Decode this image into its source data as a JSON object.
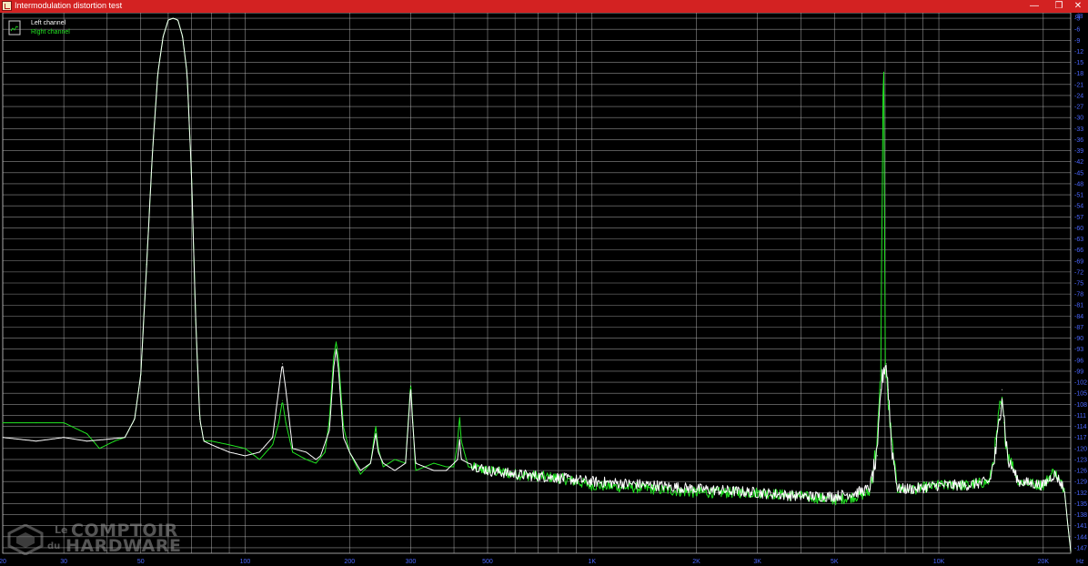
{
  "window": {
    "title": "Intermodulation distortion test",
    "minimize_glyph": "—",
    "restore_glyph": "❐",
    "close_glyph": "✕"
  },
  "watermark": {
    "line1_prefix": "Le",
    "line1": "COMPTOIR",
    "line2_prefix": "du",
    "line2": "HARDWARE"
  },
  "chart_data": {
    "type": "line",
    "title": "",
    "xlabel": "",
    "ylabel": "",
    "x_unit": "Hz",
    "y_unit": "dB",
    "x_scale": "log",
    "xlim": [
      20,
      24000
    ],
    "ylim": [
      -148.5,
      -1.5
    ],
    "grid": true,
    "legend_position": "top-left",
    "background_color": "#000000",
    "grid_color": "#bdbdbd",
    "axis_label_color": "#4a66ff",
    "x_ticks": [
      {
        "value": 20,
        "label": "20"
      },
      {
        "value": 30,
        "label": "30"
      },
      {
        "value": 50,
        "label": "50"
      },
      {
        "value": 100,
        "label": "100"
      },
      {
        "value": 200,
        "label": "200"
      },
      {
        "value": 300,
        "label": "300"
      },
      {
        "value": 500,
        "label": "500"
      },
      {
        "value": 1000,
        "label": "1K"
      },
      {
        "value": 2000,
        "label": "2K"
      },
      {
        "value": 3000,
        "label": "3K"
      },
      {
        "value": 5000,
        "label": "5K"
      },
      {
        "value": 10000,
        "label": "10K"
      },
      {
        "value": 20000,
        "label": "20K"
      }
    ],
    "y_ticks": [
      -3,
      -6,
      -9,
      -12,
      -15,
      -18,
      -21,
      -24,
      -27,
      -30,
      -33,
      -36,
      -39,
      -42,
      -45,
      -48,
      -51,
      -54,
      -57,
      -60,
      -63,
      -66,
      -69,
      -72,
      -75,
      -78,
      -81,
      -84,
      -87,
      -90,
      -93,
      -96,
      -99,
      -102,
      -105,
      -108,
      -111,
      -114,
      -117,
      -120,
      -123,
      -126,
      -129,
      -132,
      -135,
      -138,
      -141,
      -144,
      -147
    ],
    "series": [
      {
        "name": "Left channel",
        "color": "#ffffff",
        "points": [
          [
            20,
            -117
          ],
          [
            25,
            -118
          ],
          [
            30,
            -117
          ],
          [
            35,
            -118
          ],
          [
            40,
            -117.5
          ],
          [
            45,
            -117
          ],
          [
            48,
            -112
          ],
          [
            50,
            -100
          ],
          [
            52,
            -70
          ],
          [
            54,
            -40
          ],
          [
            56,
            -18
          ],
          [
            58,
            -8
          ],
          [
            60,
            -3.5
          ],
          [
            62,
            -3
          ],
          [
            64,
            -3.5
          ],
          [
            66,
            -8
          ],
          [
            68,
            -18
          ],
          [
            70,
            -45
          ],
          [
            72,
            -85
          ],
          [
            74,
            -112
          ],
          [
            76,
            -118
          ],
          [
            80,
            -119
          ],
          [
            90,
            -121
          ],
          [
            100,
            -122
          ],
          [
            110,
            -121
          ],
          [
            120,
            -117
          ],
          [
            125,
            -104
          ],
          [
            128,
            -97
          ],
          [
            131,
            -104
          ],
          [
            137,
            -120
          ],
          [
            150,
            -121
          ],
          [
            160,
            -123
          ],
          [
            165,
            -122
          ],
          [
            175,
            -115
          ],
          [
            180,
            -98
          ],
          [
            183,
            -93
          ],
          [
            186,
            -99
          ],
          [
            192,
            -117
          ],
          [
            200,
            -121
          ],
          [
            215,
            -126
          ],
          [
            230,
            -124
          ],
          [
            238,
            -116
          ],
          [
            242,
            -121
          ],
          [
            250,
            -124
          ],
          [
            270,
            -126
          ],
          [
            290,
            -124
          ],
          [
            296,
            -112
          ],
          [
            300,
            -103
          ],
          [
            304,
            -113
          ],
          [
            310,
            -124
          ],
          [
            350,
            -126
          ],
          [
            380,
            -126
          ],
          [
            400,
            -124
          ],
          [
            410,
            -123
          ],
          [
            415,
            -117
          ],
          [
            420,
            -123
          ],
          [
            440,
            -124
          ],
          [
            500,
            -126
          ],
          [
            600,
            -127
          ],
          [
            800,
            -128
          ],
          [
            1000,
            -129
          ],
          [
            1500,
            -130
          ],
          [
            2000,
            -131
          ],
          [
            3000,
            -132
          ],
          [
            4000,
            -133
          ],
          [
            5000,
            -133
          ],
          [
            5800,
            -132
          ],
          [
            6300,
            -131
          ],
          [
            6650,
            -122
          ],
          [
            6800,
            -104
          ],
          [
            6950,
            -98
          ],
          [
            7050,
            -97
          ],
          [
            7150,
            -104
          ],
          [
            7300,
            -119
          ],
          [
            7600,
            -131
          ],
          [
            8500,
            -131
          ],
          [
            10000,
            -130
          ],
          [
            12000,
            -130
          ],
          [
            14000,
            -129
          ],
          [
            14600,
            -121
          ],
          [
            15000,
            -111
          ],
          [
            15200,
            -104
          ],
          [
            15400,
            -111
          ],
          [
            15800,
            -123
          ],
          [
            17000,
            -129
          ],
          [
            20000,
            -130
          ],
          [
            21500,
            -127
          ],
          [
            22000,
            -128
          ],
          [
            23000,
            -131
          ],
          [
            23500,
            -140
          ],
          [
            24000,
            -148
          ]
        ]
      },
      {
        "name": "Right channel",
        "color": "#22e622",
        "points": [
          [
            20,
            -113
          ],
          [
            25,
            -113
          ],
          [
            30,
            -113
          ],
          [
            35,
            -116
          ],
          [
            38,
            -120
          ],
          [
            42,
            -118
          ],
          [
            45,
            -117
          ],
          [
            48,
            -112
          ],
          [
            50,
            -100
          ],
          [
            52,
            -70
          ],
          [
            54,
            -40
          ],
          [
            56,
            -18
          ],
          [
            58,
            -8
          ],
          [
            60,
            -3.5
          ],
          [
            62,
            -3
          ],
          [
            64,
            -3.5
          ],
          [
            66,
            -8
          ],
          [
            68,
            -18
          ],
          [
            70,
            -45
          ],
          [
            72,
            -85
          ],
          [
            74,
            -112
          ],
          [
            76,
            -118
          ],
          [
            80,
            -118
          ],
          [
            90,
            -119
          ],
          [
            100,
            -120
          ],
          [
            110,
            -123
          ],
          [
            120,
            -119
          ],
          [
            125,
            -113
          ],
          [
            128,
            -107
          ],
          [
            131,
            -113
          ],
          [
            137,
            -121
          ],
          [
            150,
            -123
          ],
          [
            160,
            -124
          ],
          [
            170,
            -121
          ],
          [
            175,
            -112
          ],
          [
            180,
            -95
          ],
          [
            183,
            -91
          ],
          [
            186,
            -96
          ],
          [
            192,
            -114
          ],
          [
            200,
            -121
          ],
          [
            215,
            -127
          ],
          [
            230,
            -124
          ],
          [
            238,
            -114
          ],
          [
            242,
            -120
          ],
          [
            250,
            -125
          ],
          [
            270,
            -123
          ],
          [
            290,
            -124
          ],
          [
            296,
            -111
          ],
          [
            300,
            -102
          ],
          [
            304,
            -112
          ],
          [
            310,
            -126
          ],
          [
            350,
            -124
          ],
          [
            380,
            -125
          ],
          [
            400,
            -125
          ],
          [
            410,
            -118
          ],
          [
            415,
            -111
          ],
          [
            420,
            -118
          ],
          [
            440,
            -125
          ],
          [
            500,
            -126
          ],
          [
            600,
            -127
          ],
          [
            800,
            -128
          ],
          [
            1000,
            -130
          ],
          [
            1500,
            -131
          ],
          [
            2000,
            -132
          ],
          [
            3000,
            -132
          ],
          [
            4000,
            -133
          ],
          [
            5000,
            -134
          ],
          [
            5800,
            -133
          ],
          [
            6300,
            -132
          ],
          [
            6650,
            -118
          ],
          [
            6800,
            -100
          ],
          [
            6900,
            -25
          ],
          [
            6950,
            -18
          ],
          [
            7000,
            -97
          ],
          [
            7100,
            -104
          ],
          [
            7300,
            -118
          ],
          [
            7600,
            -131
          ],
          [
            8500,
            -131
          ],
          [
            10000,
            -130
          ],
          [
            12000,
            -130
          ],
          [
            14000,
            -129
          ],
          [
            14600,
            -119
          ],
          [
            15000,
            -109
          ],
          [
            15200,
            -108
          ],
          [
            15400,
            -113
          ],
          [
            15800,
            -121
          ],
          [
            17000,
            -129
          ],
          [
            20000,
            -130
          ],
          [
            21500,
            -126
          ],
          [
            22000,
            -128
          ],
          [
            23000,
            -131
          ],
          [
            23500,
            -140
          ],
          [
            24000,
            -148
          ]
        ]
      }
    ]
  }
}
